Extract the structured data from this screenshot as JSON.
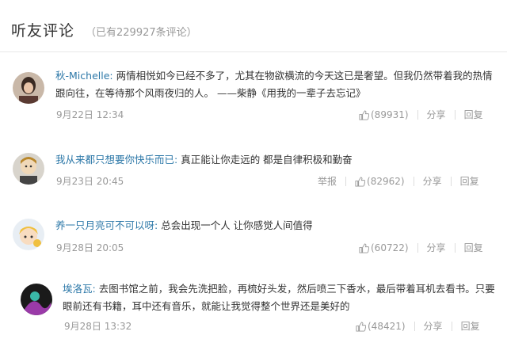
{
  "header": {
    "title": "听友评论",
    "count_text": "（已有229927条评论）"
  },
  "labels": {
    "report": "举报",
    "share": "分享",
    "reply": "回复"
  },
  "comments": [
    {
      "user": "秋-Michelle",
      "text": "两情相悦如今已经不多了，尤其在物欲横流的今天这已是奢望。但我仍然带着我的热情跟向往，在等待那个风雨夜归的人。 ——柴静《用我的一辈子去忘记》",
      "time": "9月22日 12:34",
      "likes": "(89931)"
    },
    {
      "user": "我从来都只想要你快乐而已",
      "text": "真正能让你走远的 都是自律积极和勤奋",
      "time": "9月23日 20:45",
      "likes": "(82962)"
    },
    {
      "user": "养一只月亮可不可以呀",
      "text": "总会出现一个人 让你感觉人间值得",
      "time": "9月28日 20:05",
      "likes": "(60722)"
    },
    {
      "user": "埃洛瓦",
      "text": "去图书馆之前，我会先洗把脸，再梳好头发，然后喷三下香水，最后带着耳机去看书。只要眼前还有书籍，耳中还有音乐，就能让我觉得整个世界还是美好的",
      "time": "9月28日 13:32",
      "likes": "(48421)"
    }
  ],
  "colors": {
    "username": "#2d78a8",
    "meta": "#999999",
    "divider": "#e8e8e8"
  }
}
